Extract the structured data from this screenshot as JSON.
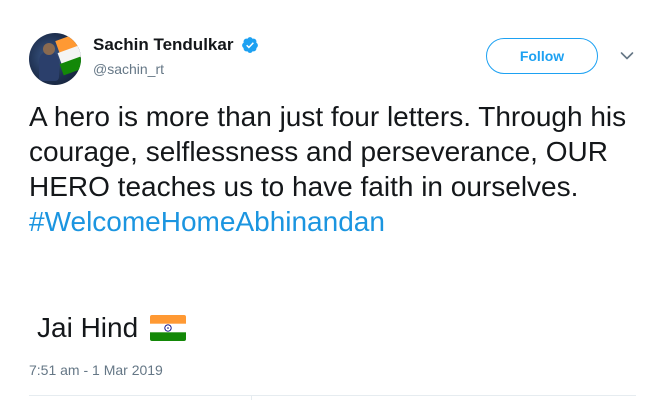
{
  "user": {
    "display_name": "Sachin Tendulkar",
    "handle": "@sachin_rt",
    "verified": true
  },
  "actions": {
    "follow_label": "Follow"
  },
  "tweet": {
    "text": "A hero is more than just four letters. Through his courage, selflessness and perseverance, OUR HERO teaches us to have faith in ourselves.",
    "hashtag": "#WelcomeHomeAbhinandan",
    "closing": "Jai Hind",
    "timestamp": "7:51 am - 1 Mar 2019"
  },
  "icons": {
    "verified": "verified-badge-icon",
    "caret": "chevron-down-icon",
    "flag": "india-flag-emoji"
  },
  "colors": {
    "accent": "#1da1f2",
    "hashtag": "#1b95e0",
    "text": "#14171a",
    "secondary": "#657786"
  }
}
